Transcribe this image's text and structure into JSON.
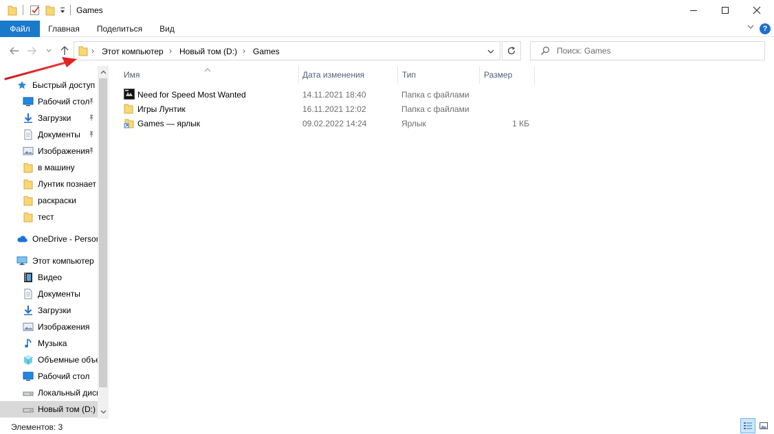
{
  "window": {
    "title": "Games",
    "minimize_glyph": "—",
    "close_glyph": "✕"
  },
  "ribbon": {
    "tabs": [
      "Файл",
      "Главная",
      "Поделиться",
      "Вид"
    ],
    "help_glyph": "?"
  },
  "address": {
    "crumbs": [
      "Этот компьютер",
      "Новый том (D:)",
      "Games"
    ],
    "separator": "›"
  },
  "search": {
    "placeholder": "Поиск: Games"
  },
  "navigation": {
    "items": [
      {
        "label": "Быстрый доступ",
        "icon": "star-icon",
        "level": 0,
        "pinned": false
      },
      {
        "label": "Рабочий стол",
        "icon": "desktop-icon",
        "level": 1,
        "pinned": true
      },
      {
        "label": "Загрузки",
        "icon": "download-icon",
        "level": 1,
        "pinned": true
      },
      {
        "label": "Документы",
        "icon": "document-icon",
        "level": 1,
        "pinned": true
      },
      {
        "label": "Изображения",
        "icon": "pictures-icon",
        "level": 1,
        "pinned": true
      },
      {
        "label": "в машину",
        "icon": "folder-icon",
        "level": 1,
        "pinned": false
      },
      {
        "label": "Лунтик познает мир",
        "icon": "folder-icon",
        "level": 1,
        "pinned": false
      },
      {
        "label": "раскраски",
        "icon": "folder-icon",
        "level": 1,
        "pinned": false
      },
      {
        "label": "тест",
        "icon": "folder-icon",
        "level": 1,
        "pinned": false
      },
      {
        "label": "OneDrive - Personal",
        "icon": "cloud-icon",
        "level": 0,
        "pinned": false
      },
      {
        "label": "Этот компьютер",
        "icon": "computer-icon",
        "level": 0,
        "pinned": false
      },
      {
        "label": "Видео",
        "icon": "video-icon",
        "level": 1,
        "pinned": false
      },
      {
        "label": "Документы",
        "icon": "document-icon",
        "level": 1,
        "pinned": false
      },
      {
        "label": "Загрузки",
        "icon": "download-icon",
        "level": 1,
        "pinned": false
      },
      {
        "label": "Изображения",
        "icon": "pictures-icon",
        "level": 1,
        "pinned": false
      },
      {
        "label": "Музыка",
        "icon": "music-icon",
        "level": 1,
        "pinned": false
      },
      {
        "label": "Объемные объекты",
        "icon": "cube-icon",
        "level": 1,
        "pinned": false
      },
      {
        "label": "Рабочий стол",
        "icon": "desktop-icon",
        "level": 1,
        "pinned": false
      },
      {
        "label": "Локальный диск (C:)",
        "icon": "drive-icon",
        "level": 1,
        "pinned": false
      },
      {
        "label": "Новый том (D:)",
        "icon": "drive-icon",
        "level": 1,
        "pinned": false,
        "selected": true
      }
    ]
  },
  "columns": {
    "name": "Имя",
    "date": "Дата изменения",
    "type": "Тип",
    "size": "Размер"
  },
  "files": [
    {
      "name": "Need for Speed Most Wanted",
      "date": "14.11.2021 18:40",
      "type": "Папка с файлами",
      "size": "",
      "icon": "game-folder-icon"
    },
    {
      "name": "Игры Лунтик",
      "date": "16.11.2021 12:02",
      "type": "Папка с файлами",
      "size": "",
      "icon": "folder-icon"
    },
    {
      "name": "Games — ярлык",
      "date": "09.02.2022 14:24",
      "type": "Ярлык",
      "size": "1 КБ",
      "icon": "shortcut-icon"
    }
  ],
  "status": {
    "count_text": "Элементов: 3"
  },
  "colors": {
    "accent": "#1979ca",
    "folder": "#f8d775",
    "annotation_arrow": "#e02424"
  }
}
